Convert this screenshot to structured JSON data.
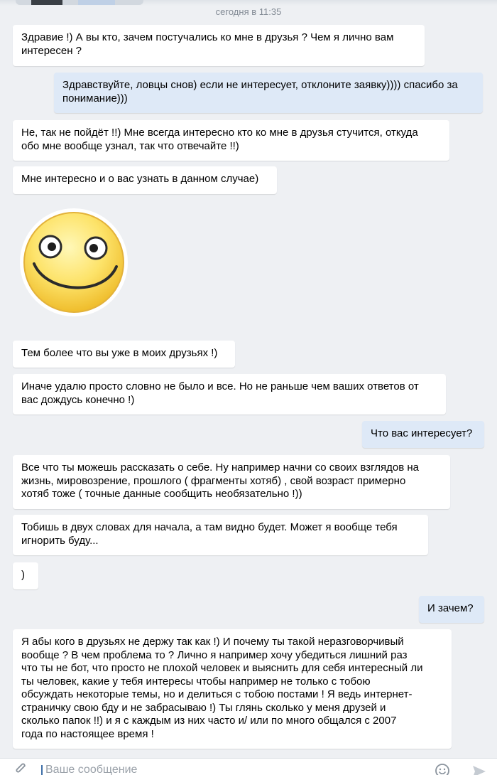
{
  "date_separator": "сегодня в 11:35",
  "messages": [
    {
      "dir": "in",
      "lines": [
        "Здравие !) А вы кто, зачем постучались ко мне в друзья ? Чем я лично вам",
        "интересен ?"
      ]
    },
    {
      "dir": "out",
      "lines": [
        "Здравствуйте, ловцы снов) если не интересует, отклоните заявку)))) спасибо за",
        "понимание)))"
      ]
    },
    {
      "dir": "in",
      "lines": [
        "Не, так не пойдёт !!) Мне всегда интересно кто ко мне в друзья стучится, откуда",
        "обо мне вообще узнал, так что отвечайте !!)"
      ]
    },
    {
      "dir": "in",
      "lines": [
        "Мне интересно и о вас узнать в данном случае)"
      ]
    },
    {
      "dir": "in",
      "lines": [
        "Тем более что вы уже в моих друзьях !)"
      ]
    },
    {
      "dir": "in",
      "lines": [
        "Иначе удалю просто словно не было и все. Но не раньше чем ваших ответов от",
        "вас дождусь конечно !)"
      ]
    },
    {
      "dir": "out",
      "lines": [
        "Что вас интересует?"
      ]
    },
    {
      "dir": "in",
      "lines": [
        "Все что ты можешь рассказать о себе. Ну например начни со своих взглядов на",
        "жизнь, мировозрение, прошлого ( фрагменты хотяб)  , свой возраст примерно",
        "хотяб тоже ( точные данные сообщить необязательно !))"
      ]
    },
    {
      "dir": "in",
      "lines": [
        "Тобишь в двух словах для начала, а там видно будет. Может я вообще тебя",
        "игнорить буду..."
      ]
    },
    {
      "dir": "in",
      "lines": [
        ")"
      ]
    },
    {
      "dir": "out",
      "lines": [
        "И зачем?"
      ]
    },
    {
      "dir": "in",
      "lines": [
        "Я абы кого в друзьях не держу так как !) И почему ты такой неразговорчивый",
        "вообще ? В чем проблема то ? Лично я например хочу убедиться лишний раз",
        "что ты не бот, что просто не плохой человек и выяснить для себя интересный ли",
        "ты человек, какие у тебя интересы чтобы например не только с тобою",
        "обсуждать некоторые темы, но и делиться с тобою постами ! Я ведь интернет-",
        "страничку свою бду и не забрасываю !) Ты глянь сколько у меня друзей и",
        "сколько папок !!) и я с каждым из них часто и/ или по много общался с 2007",
        "года по настоящее время !"
      ]
    }
  ],
  "composer": {
    "placeholder": "Ваше сообщение"
  },
  "colors": {
    "background": "#eef0f3",
    "incoming_bubble": "#ffffff",
    "outgoing_bubble": "#dee9f7",
    "accent": "#3e6fa8"
  },
  "icons": {
    "attach": "paperclip-icon",
    "emoji": "emoji-icon",
    "send": "send-icon",
    "sticker": "smiley-sticker"
  }
}
